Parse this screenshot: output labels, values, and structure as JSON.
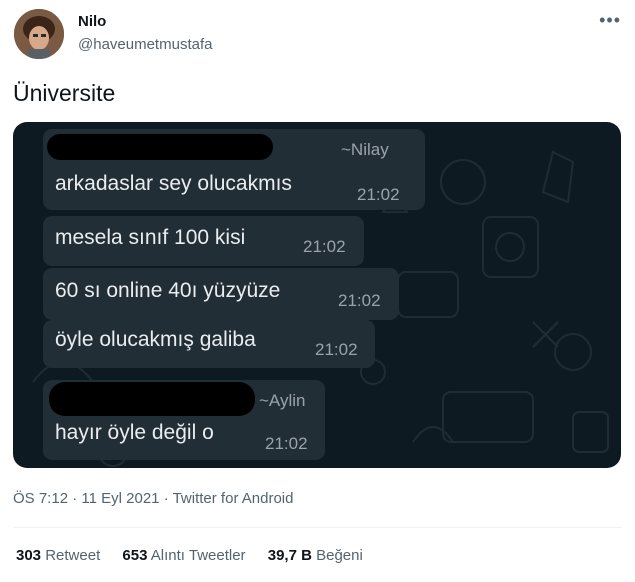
{
  "user": {
    "name": "Nilo",
    "handle": "@haveumetmustafa"
  },
  "tweet": {
    "text": "Üniversite"
  },
  "chat": {
    "messages": [
      {
        "sender": "~Nilay",
        "text": "arkadaslar sey olucakmıs",
        "time": "21:02"
      },
      {
        "text": "mesela sınıf 100 kisi",
        "time": "21:02"
      },
      {
        "text": "60 sı online 40ı yüzyüze",
        "time": "21:02"
      },
      {
        "text": "öyle olucakmış galiba",
        "time": "21:02"
      },
      {
        "sender": "~Aylin",
        "text": "hayır öyle değil o",
        "time": "21:02"
      }
    ]
  },
  "meta": {
    "time": "ÖS 7:12",
    "date": "11 Eyl 2021",
    "source": "Twitter for Android",
    "sep": "·"
  },
  "stats": {
    "retweets_count": "303",
    "retweets_label": "Retweet",
    "quotes_count": "653",
    "quotes_label": "Alıntı Tweetler",
    "likes_count": "39,7 B",
    "likes_label": "Beğeni"
  },
  "colors": {
    "chat_background": "#0e1a21",
    "bubble": "#222e35",
    "bubble_text": "#e9edef",
    "secondary_text": "#536471"
  },
  "icons": {
    "more": "more-horizontal-icon"
  }
}
